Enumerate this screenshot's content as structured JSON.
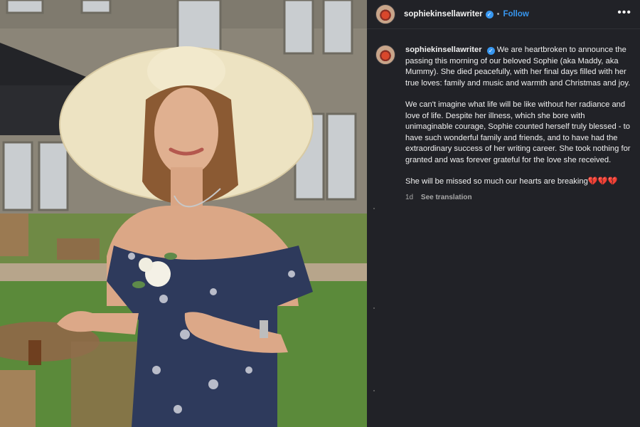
{
  "header": {
    "username": "sophiekinsellawriter",
    "follow_label": "Follow",
    "separator": "•",
    "more_label": "•••"
  },
  "post": {
    "username": "sophiekinsellawriter",
    "paragraph1": "We are heartbroken to announce the passing this morning of our beloved Sophie (aka Maddy, aka Mummy). She died peacefully, with her final days filled with her true loves: family and music and warmth and Christmas and joy.",
    "paragraph2": "We can't imagine what life will be like without her radiance and love of life. Despite her illness, which she bore with unimaginable courage, Sophie counted herself truly blessed - to have such wonderful family and friends, and to have had the extraordinary success of her writing career. She took nothing for granted and was forever grateful for the love she received.",
    "paragraph3": "She will be missed so much our hearts are breaking💔💔💔",
    "timestamp": "1d",
    "see_translation": "See translation"
  },
  "icons": {
    "verified": "verified-badge-icon",
    "more": "more-options-icon"
  },
  "colors": {
    "panel_bg": "#212227",
    "link_blue": "#3797f0",
    "text_primary": "#f5f5f5",
    "text_secondary": "#a8a8a8"
  }
}
